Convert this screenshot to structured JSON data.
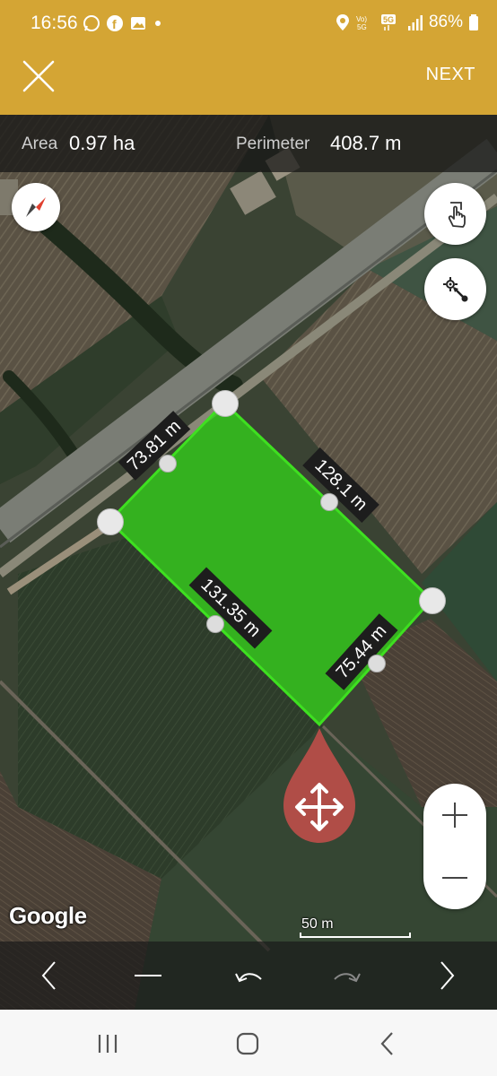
{
  "status": {
    "time": "16:56",
    "battery": "86%",
    "network": "5G"
  },
  "header": {
    "next_label": "NEXT"
  },
  "measure": {
    "area_label": "Area",
    "area_value": "0.97 ha",
    "perimeter_label": "Perimeter",
    "perimeter_value": "408.7 m"
  },
  "edges": [
    "73.81 m",
    "128.1 m",
    "131.35 m",
    "75.44 m"
  ],
  "map": {
    "attribution": "Google",
    "scale_label": "50 m",
    "polygon_color": "#33d11a"
  },
  "icons": {
    "compass": "compass-icon",
    "touch": "hand-pointer-icon",
    "gps": "gps-point-icon",
    "zoom_in": "plus-icon",
    "zoom_out": "minus-icon",
    "move": "move-arrows-icon"
  },
  "zoom": {
    "in_label": "+",
    "out_label": "—"
  }
}
